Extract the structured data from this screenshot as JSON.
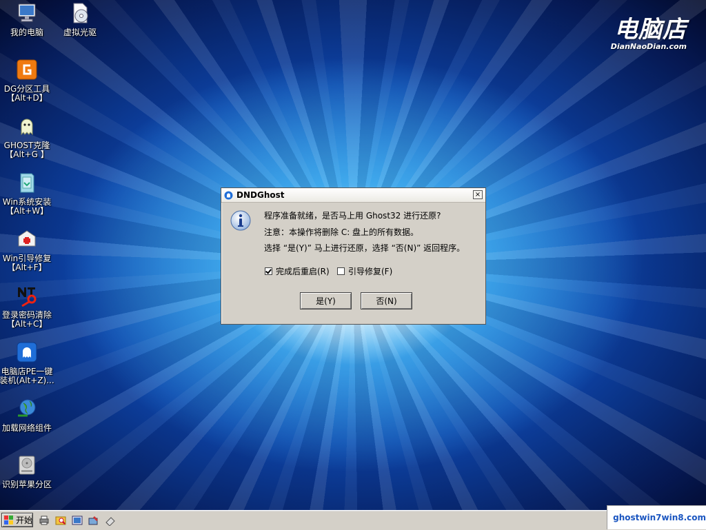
{
  "desktop": {
    "icons": [
      {
        "label": "我的电脑",
        "sub": ""
      },
      {
        "label": "虚拟光驱",
        "sub": ""
      },
      {
        "label": "DG分区工具",
        "sub": "【Alt+D】"
      },
      {
        "label": "GHOST克隆",
        "sub": "【Alt+G 】"
      },
      {
        "label": "Win系统安装",
        "sub": "【Alt+W】"
      },
      {
        "label": "Win引导修复",
        "sub": "【Alt+F】"
      },
      {
        "label": "登录密码清除",
        "sub": "【Alt+C】"
      },
      {
        "label": "电脑店PE一键",
        "sub": "装机(Alt+Z)..."
      },
      {
        "label": "加载网络组件",
        "sub": ""
      },
      {
        "label": "识别苹果分区",
        "sub": ""
      }
    ],
    "brand": {
      "name": "电脑店",
      "url": "DianNaoDian.com"
    }
  },
  "dialog": {
    "title": "DNDGhost",
    "close_label": "×",
    "line1": "程序准备就绪，是否马上用 Ghost32 进行还原?",
    "line2": "注意：本操作将删除 C: 盘上的所有数据。",
    "line3": "选择 “是(Y)” 马上进行还原，选择 “否(N)” 返回程序。",
    "checkbox_restart": {
      "label": "完成后重启(R)",
      "checked": true
    },
    "checkbox_bootfix": {
      "label": "引导修复(F)",
      "checked": false
    },
    "yes_label": "是(Y)",
    "no_label": "否(N)"
  },
  "taskbar": {
    "start_label": "开始",
    "quick_launch": [
      "printer-icon",
      "explorer-search-icon",
      "desktop-window-icon",
      "tools-icon",
      "eraser-icon"
    ]
  },
  "watermark": {
    "text": "ghostwin7win8.com"
  }
}
